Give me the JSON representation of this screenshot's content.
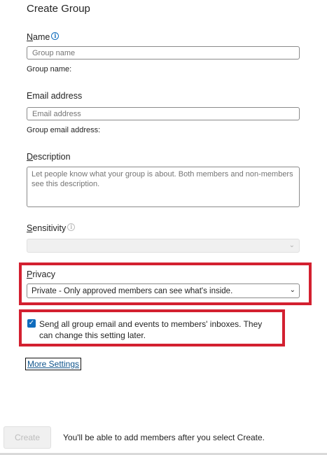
{
  "dialog": {
    "title": "Create Group"
  },
  "name": {
    "label_first": "N",
    "label_rest": "ame",
    "info_icon": "info-icon",
    "placeholder": "Group name",
    "helper": "Group name:"
  },
  "email": {
    "label": "Email address",
    "placeholder": "Email address",
    "helper": "Group email address:"
  },
  "description": {
    "label_first": "D",
    "label_rest": "escription",
    "placeholder": "Let people know what your group is about. Both members and non-members see this description."
  },
  "sensitivity": {
    "label_first": "S",
    "label_rest": "ensitivity",
    "info_icon": "info-icon",
    "value": ""
  },
  "privacy": {
    "label_first": "P",
    "label_rest": "rivacy",
    "selected": "Private - Only approved members can see what's inside.",
    "dropdown_icon": "chevron-down-icon"
  },
  "send_copies": {
    "checked": true,
    "text_a": "Sen",
    "text_u": "d",
    "text_b": " all group email and events to members' inboxes. They can change this setting later."
  },
  "more_settings": {
    "label": "More Settings"
  },
  "footer": {
    "create_label": "Create",
    "note": "You'll be able to add members after you select Create."
  },
  "colors": {
    "accent": "#0f6cbd",
    "highlight_box": "#d32030",
    "disabled_bg": "#f0f0f0"
  }
}
